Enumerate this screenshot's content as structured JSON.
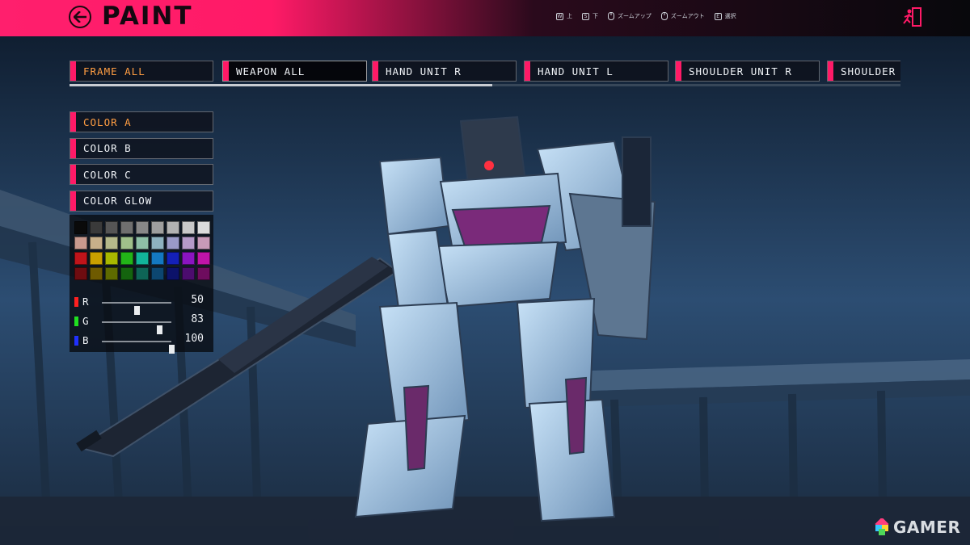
{
  "header": {
    "title": "PAINT",
    "back_icon": "arrow-left-icon",
    "exit_icon": "exit-door-icon",
    "hints": [
      {
        "key": "W",
        "label": "上",
        "icon": "key-w-icon"
      },
      {
        "key": "S",
        "label": "下",
        "icon": "key-s-icon"
      },
      {
        "key": "",
        "label": "ズームアップ",
        "icon": "mouse-icon"
      },
      {
        "key": "",
        "label": "ズームアウト",
        "icon": "mouse-icon"
      },
      {
        "key": "E",
        "label": "選択",
        "icon": "key-e-icon"
      }
    ]
  },
  "tabs": [
    {
      "label": "FRAME ALL",
      "state": "active"
    },
    {
      "label": "WEAPON ALL",
      "state": "selected"
    },
    {
      "label": "HAND UNIT R",
      "state": ""
    },
    {
      "label": "HAND UNIT L",
      "state": ""
    },
    {
      "label": "SHOULDER UNIT R",
      "state": ""
    },
    {
      "label": "SHOULDER",
      "state": ""
    }
  ],
  "color_slots": [
    {
      "label": "COLOR A",
      "state": "active"
    },
    {
      "label": "COLOR B",
      "state": ""
    },
    {
      "label": "COLOR C",
      "state": ""
    },
    {
      "label": "COLOR GLOW",
      "state": ""
    }
  ],
  "palette": [
    "#0a0a0a",
    "#3a3a3a",
    "#555555",
    "#6f6f6f",
    "#888888",
    "#9e9e9e",
    "#b2b2b2",
    "#c8c8c8",
    "#dcdcdc",
    "#c99a8e",
    "#c8b08a",
    "#b5b98a",
    "#9fc08a",
    "#8ec0a6",
    "#8eb2c0",
    "#9a9ac8",
    "#b59ac8",
    "#c89ab8",
    "#c0141a",
    "#c9a000",
    "#a8b800",
    "#22b418",
    "#12b49a",
    "#1478c0",
    "#1420b8",
    "#8a14c0",
    "#c014a8",
    "#6e0c10",
    "#6e5a00",
    "#5e6a00",
    "#14640e",
    "#0e6456",
    "#0c4670",
    "#0c126a",
    "#4c0c6e",
    "#6e0c5e"
  ],
  "sliders": [
    {
      "channel": "R",
      "value": 50,
      "color": "#ff2020"
    },
    {
      "channel": "G",
      "value": 83,
      "color": "#20e020"
    },
    {
      "channel": "B",
      "value": 100,
      "color": "#2030ff"
    }
  ],
  "watermark": {
    "text": "GAMER",
    "icon": "gamer-logo-icon"
  },
  "colors": {
    "accent": "#ff1a67",
    "active_text": "#ff9d42"
  }
}
